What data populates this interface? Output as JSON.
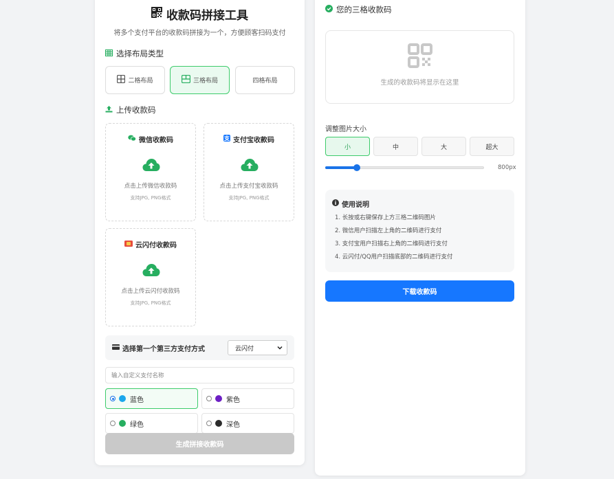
{
  "header": {
    "title": "收款码拼接工具",
    "subtitle": "将多个支付平台的收款码拼接为一个，方便顾客扫码支付"
  },
  "layout_section": {
    "label": "选择布局类型",
    "options": [
      {
        "label": "二格布局",
        "active": false
      },
      {
        "label": "三格布局",
        "active": true
      },
      {
        "label": "四格布局",
        "active": false
      }
    ]
  },
  "upload_section": {
    "label": "上传收款码",
    "boxes": [
      {
        "title": "微信收款码",
        "hint": "点击上传微信收款码",
        "format": "支持JPG, PNG格式",
        "icon": "wechat-icon"
      },
      {
        "title": "支付宝收款码",
        "hint": "点击上传支付宝收款码",
        "format": "支持JPG, PNG格式",
        "icon": "alipay-icon"
      },
      {
        "title": "云闪付收款码",
        "hint": "点击上传云闪付收款码",
        "format": "支持JPG, PNG格式",
        "icon": "unionpay-icon"
      }
    ]
  },
  "third_party": {
    "label": "选择第一个第三方支付方式",
    "selected": "云闪付"
  },
  "custom_name": {
    "placeholder": "输入自定义支付名称"
  },
  "colors": [
    {
      "label": "蓝色",
      "hex": "#1aa7ec",
      "active": true
    },
    {
      "label": "紫色",
      "hex": "#6d1fc4",
      "active": false
    },
    {
      "label": "绿色",
      "hex": "#27ae60",
      "active": false
    },
    {
      "label": "深色",
      "hex": "#2b2b2b",
      "active": false
    }
  ],
  "generate_button": "生成拼接收款码",
  "preview": {
    "title": "您的三格收款码",
    "placeholder": "生成的收款码将显示在这里"
  },
  "size": {
    "label": "调整图片大小",
    "options": [
      {
        "label": "小",
        "active": true
      },
      {
        "label": "中",
        "active": false
      },
      {
        "label": "大",
        "active": false
      },
      {
        "label": "超大",
        "active": false
      }
    ],
    "slider_fraction": 0.2,
    "value_text": "800px"
  },
  "help": {
    "title": "使用说明",
    "items": [
      "1. 长按或右键保存上方三格二维码图片",
      "2. 微信用户扫描左上角的二维码进行支付",
      "3. 支付宝用户扫描右上角的二维码进行支付",
      "4. 云闪付/QQ用户扫描底部的二维码进行支付"
    ]
  },
  "download_button": "下载收款码",
  "theme": {
    "green": "#3ccb6a",
    "blue": "#1677ff"
  }
}
